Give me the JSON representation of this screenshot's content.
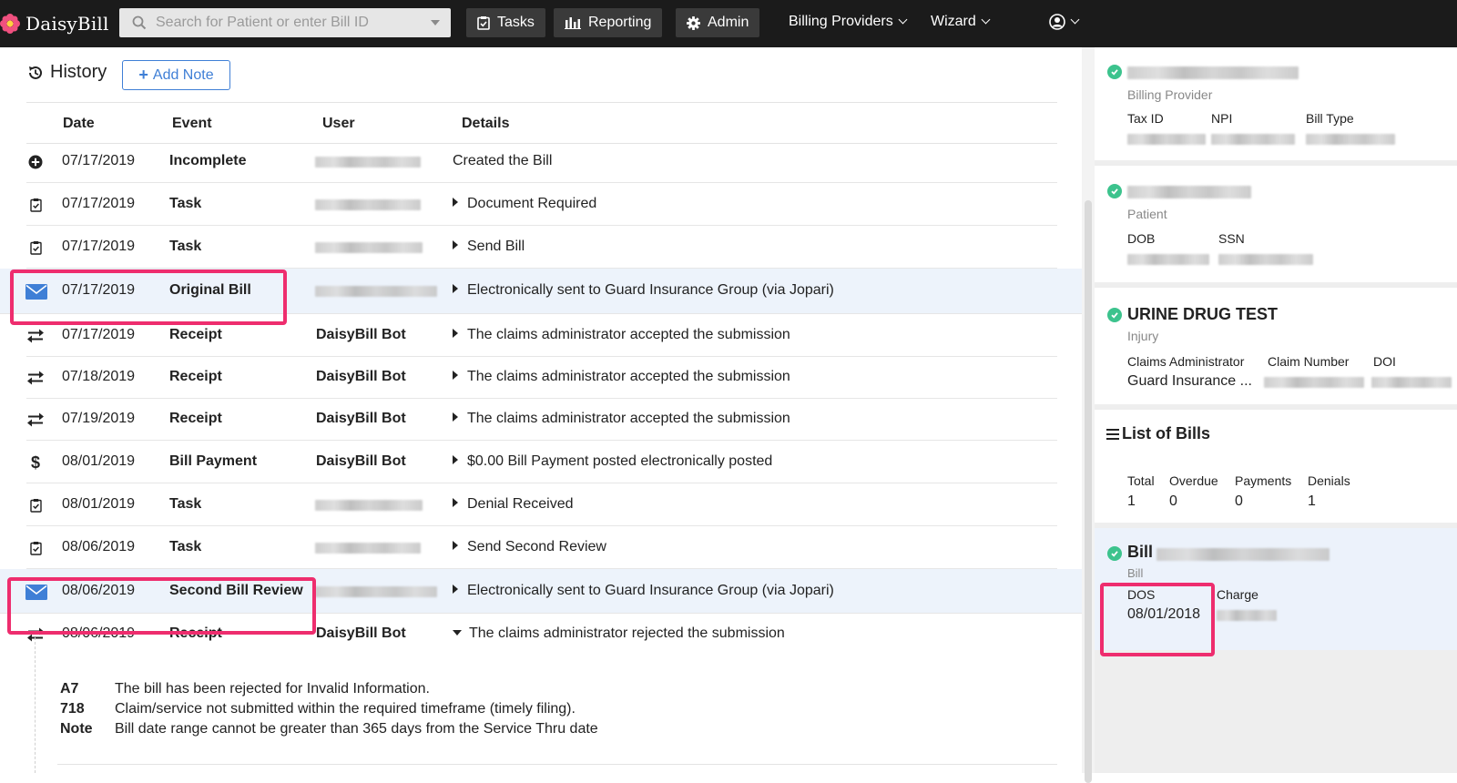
{
  "nav": {
    "logo": "DaisyBill",
    "search_placeholder": "Search for Patient or enter Bill ID",
    "tasks": "Tasks",
    "reporting": "Reporting",
    "admin": "Admin",
    "billing_providers": "Billing Providers",
    "wizard": "Wizard"
  },
  "history": {
    "title": "History",
    "add_note": "Add Note",
    "columns": [
      "Date",
      "Event",
      "User",
      "Details"
    ],
    "rows": [
      {
        "icon": "plus-circle-icon",
        "date": "07/17/2019",
        "event": "Incomplete",
        "user": "",
        "details": "Created the Bill"
      },
      {
        "icon": "clipboard-check-icon",
        "date": "07/17/2019",
        "event": "Task",
        "user": "",
        "details": "Document Required"
      },
      {
        "icon": "clipboard-check-icon",
        "date": "07/17/2019",
        "event": "Task",
        "user": "",
        "details": "Send Bill"
      },
      {
        "icon": "envelope-icon",
        "date": "07/17/2019",
        "event": "Original Bill",
        "user": "",
        "details": "Electronically sent to Guard Insurance Group (via Jopari)"
      },
      {
        "icon": "exchange-icon",
        "date": "07/17/2019",
        "event": "Receipt",
        "user": "DaisyBill Bot",
        "details": "The claims administrator accepted the submission"
      },
      {
        "icon": "exchange-icon",
        "date": "07/18/2019",
        "event": "Receipt",
        "user": "DaisyBill Bot",
        "details": "The claims administrator accepted the submission"
      },
      {
        "icon": "exchange-icon",
        "date": "07/19/2019",
        "event": "Receipt",
        "user": "DaisyBill Bot",
        "details": "The claims administrator accepted the submission"
      },
      {
        "icon": "dollar-icon",
        "date": "08/01/2019",
        "event": "Bill Payment",
        "user": "DaisyBill Bot",
        "details": "$0.00 Bill Payment posted electronically posted"
      },
      {
        "icon": "clipboard-check-icon",
        "date": "08/01/2019",
        "event": "Task",
        "user": "",
        "details": "Denial Received"
      },
      {
        "icon": "clipboard-check-icon",
        "date": "08/06/2019",
        "event": "Task",
        "user": "",
        "details": "Send Second Review"
      },
      {
        "icon": "envelope-icon",
        "date": "08/06/2019",
        "event": "Second Bill Review",
        "user": "",
        "details": "Electronically sent to Guard Insurance Group (via Jopari)"
      },
      {
        "icon": "exchange-icon",
        "date": "08/06/2019",
        "event": "Receipt",
        "user": "DaisyBill Bot",
        "details": "The claims administrator rejected the submission"
      }
    ],
    "rejection": [
      {
        "code": "A7",
        "text": "The bill has been rejected for Invalid Information."
      },
      {
        "code": "718",
        "text": "Claim/service not submitted within the required timeframe (timely filing)."
      },
      {
        "code": "Note",
        "text": "Bill date range cannot be greater than 365 days from the Service Thru date"
      }
    ]
  },
  "sidebar": {
    "billing_provider": {
      "subtitle": "Billing Provider",
      "labels": [
        "Tax ID",
        "NPI",
        "Bill Type"
      ]
    },
    "patient": {
      "subtitle": "Patient",
      "labels": [
        "DOB",
        "SSN"
      ]
    },
    "injury": {
      "title": "URINE DRUG TEST",
      "subtitle": "Injury",
      "labels": [
        "Claims Administrator",
        "Claim Number",
        "DOI"
      ],
      "claims_admin_value": "Guard Insurance ..."
    },
    "bills": {
      "title": "List of Bills",
      "labels": [
        "Total",
        "Overdue",
        "Payments",
        "Denials"
      ],
      "values": [
        "1",
        "0",
        "0",
        "1"
      ]
    },
    "bill": {
      "title": "Bill",
      "subtitle": "Bill",
      "dos_label": "DOS",
      "dos_value": "08/01/2018",
      "charge_label": "Charge"
    }
  },
  "colors": {
    "accent": "#3f7fd6",
    "highlight_box": "#ee2d6e",
    "check": "#3cc38d",
    "nav_bg": "#1b1b1b"
  }
}
